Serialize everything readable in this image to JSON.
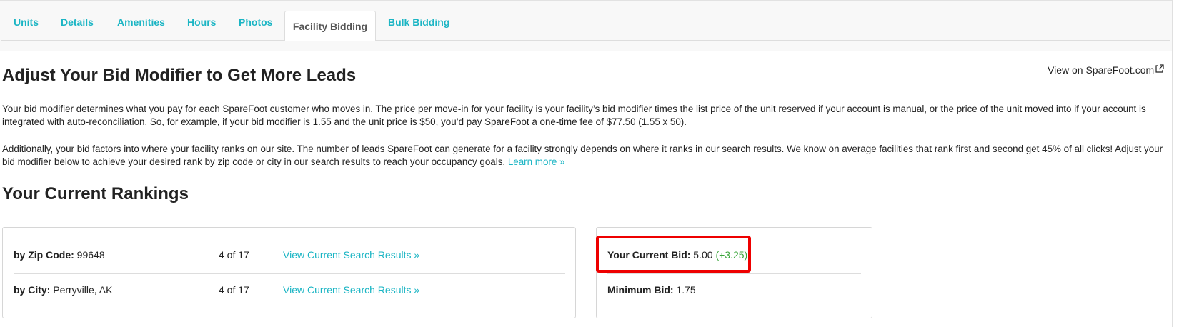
{
  "tabs": [
    {
      "label": "Units",
      "active": false
    },
    {
      "label": "Details",
      "active": false
    },
    {
      "label": "Amenities",
      "active": false
    },
    {
      "label": "Hours",
      "active": false
    },
    {
      "label": "Photos",
      "active": false
    },
    {
      "label": "Facility Bidding",
      "active": true
    },
    {
      "label": "Bulk Bidding",
      "active": false
    }
  ],
  "page": {
    "title": "Adjust Your Bid Modifier to Get More Leads",
    "external_link": "View on SpareFoot.com",
    "paragraph1": "Your bid modifier determines what you pay for each SpareFoot customer who moves in. The price per move-in for your facility is your facility’s bid modifier times the list price of the unit reserved if your account is manual, or the price of the unit moved into if your account is integrated with auto-reconciliation. So, for example, if your bid modifier is 1.55 and the unit price is $50, you’d pay SpareFoot a one-time fee of $77.50 (1.55 x 50).",
    "paragraph2": "Additionally, your bid factors into where your facility ranks on our site. The number of leads SpareFoot can generate for a facility strongly depends on where it ranks in our search results. We know on average facilities that rank first and second get 45% of all clicks! Adjust your bid modifier below to achieve your desired rank by zip code or city in our search results to reach your occupancy goals.",
    "learn_more": "Learn more »"
  },
  "rankings": {
    "heading": "Your Current Rankings",
    "rows": [
      {
        "label": "by Zip Code:",
        "value": "99648",
        "rank": "4 of 17",
        "link": "View Current Search Results »"
      },
      {
        "label": "by City:",
        "value": "Perryville, AK",
        "rank": "4 of 17",
        "link": "View Current Search Results »"
      }
    ]
  },
  "bid": {
    "current_label": "Your Current Bid:",
    "current_value": "5.00",
    "current_delta": "(+3.25)",
    "minimum_label": "Minimum Bid:",
    "minimum_value": "1.75"
  },
  "colors": {
    "accent": "#1bb5c4",
    "positive": "#3aa53a",
    "highlight": "#ee0000"
  },
  "icons": {
    "external_link": "external-link-icon"
  }
}
